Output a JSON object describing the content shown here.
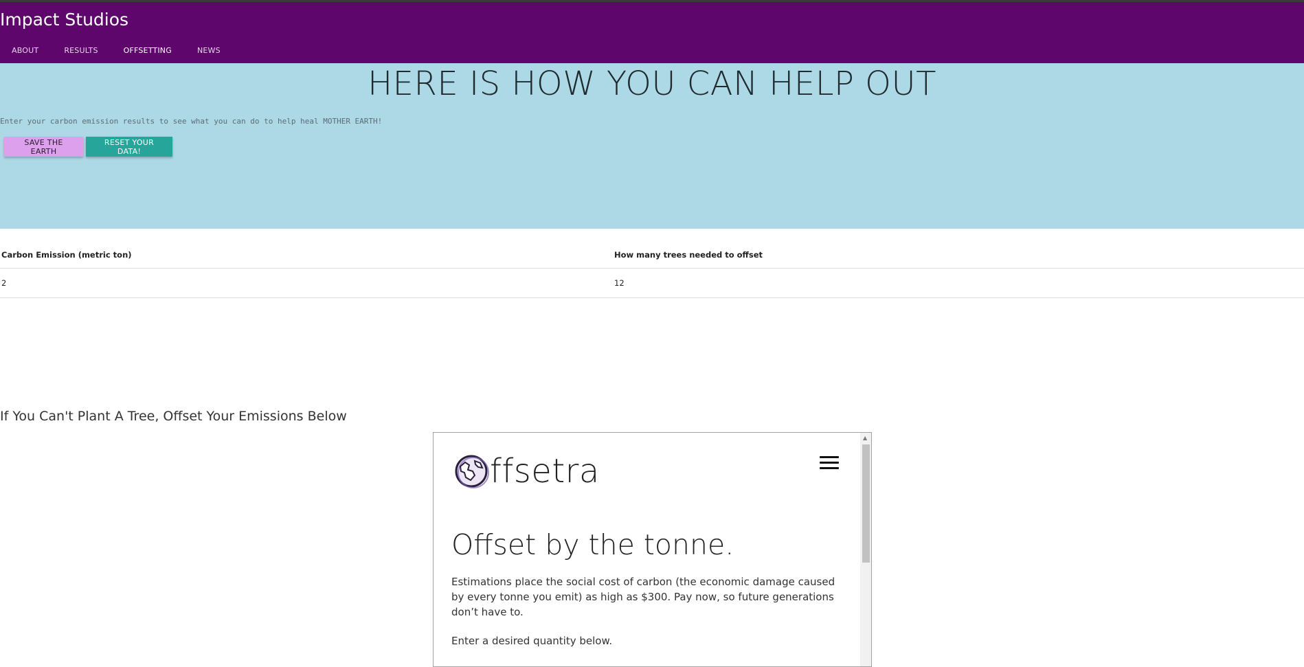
{
  "header": {
    "brand": "Impact Studios",
    "nav": [
      "ABOUT",
      "RESULTS",
      "OFFSETTING",
      "NEWS"
    ],
    "active_nav": "OFFSETTING"
  },
  "hero": {
    "title": "HERE IS HOW YOU CAN HELP OUT",
    "intro": "Enter your carbon emission results to see what you can do to help heal MOTHER EARTH!",
    "save_label": "SAVE THE EARTH",
    "reset_label": "RESET YOUR DATA!"
  },
  "table": {
    "headers": [
      "Carbon Emission (metric ton)",
      "How many trees needed to offset"
    ],
    "rows": [
      [
        "2",
        "12"
      ]
    ]
  },
  "offset_section": {
    "heading": "If You Can't Plant A Tree, Offset Your Emissions Below"
  },
  "widget": {
    "logo_text": "ffsetra",
    "heading": "Offset by the tonne.",
    "paragraph": "Estimations place the social cost of carbon (the economic damage caused by every tonne you emit) as high as $300. Pay now, so future generations don’t have to.",
    "note": "Enter a desired quantity below."
  },
  "colors": {
    "header_bg": "#5f066d",
    "hero_bg": "#add8e6",
    "save_button": "#dda0ec",
    "reset_button": "#26a69a"
  },
  "icons": [
    "globe-logo-icon",
    "hamburger-menu-icon",
    "scroll-up-arrow-icon"
  ]
}
